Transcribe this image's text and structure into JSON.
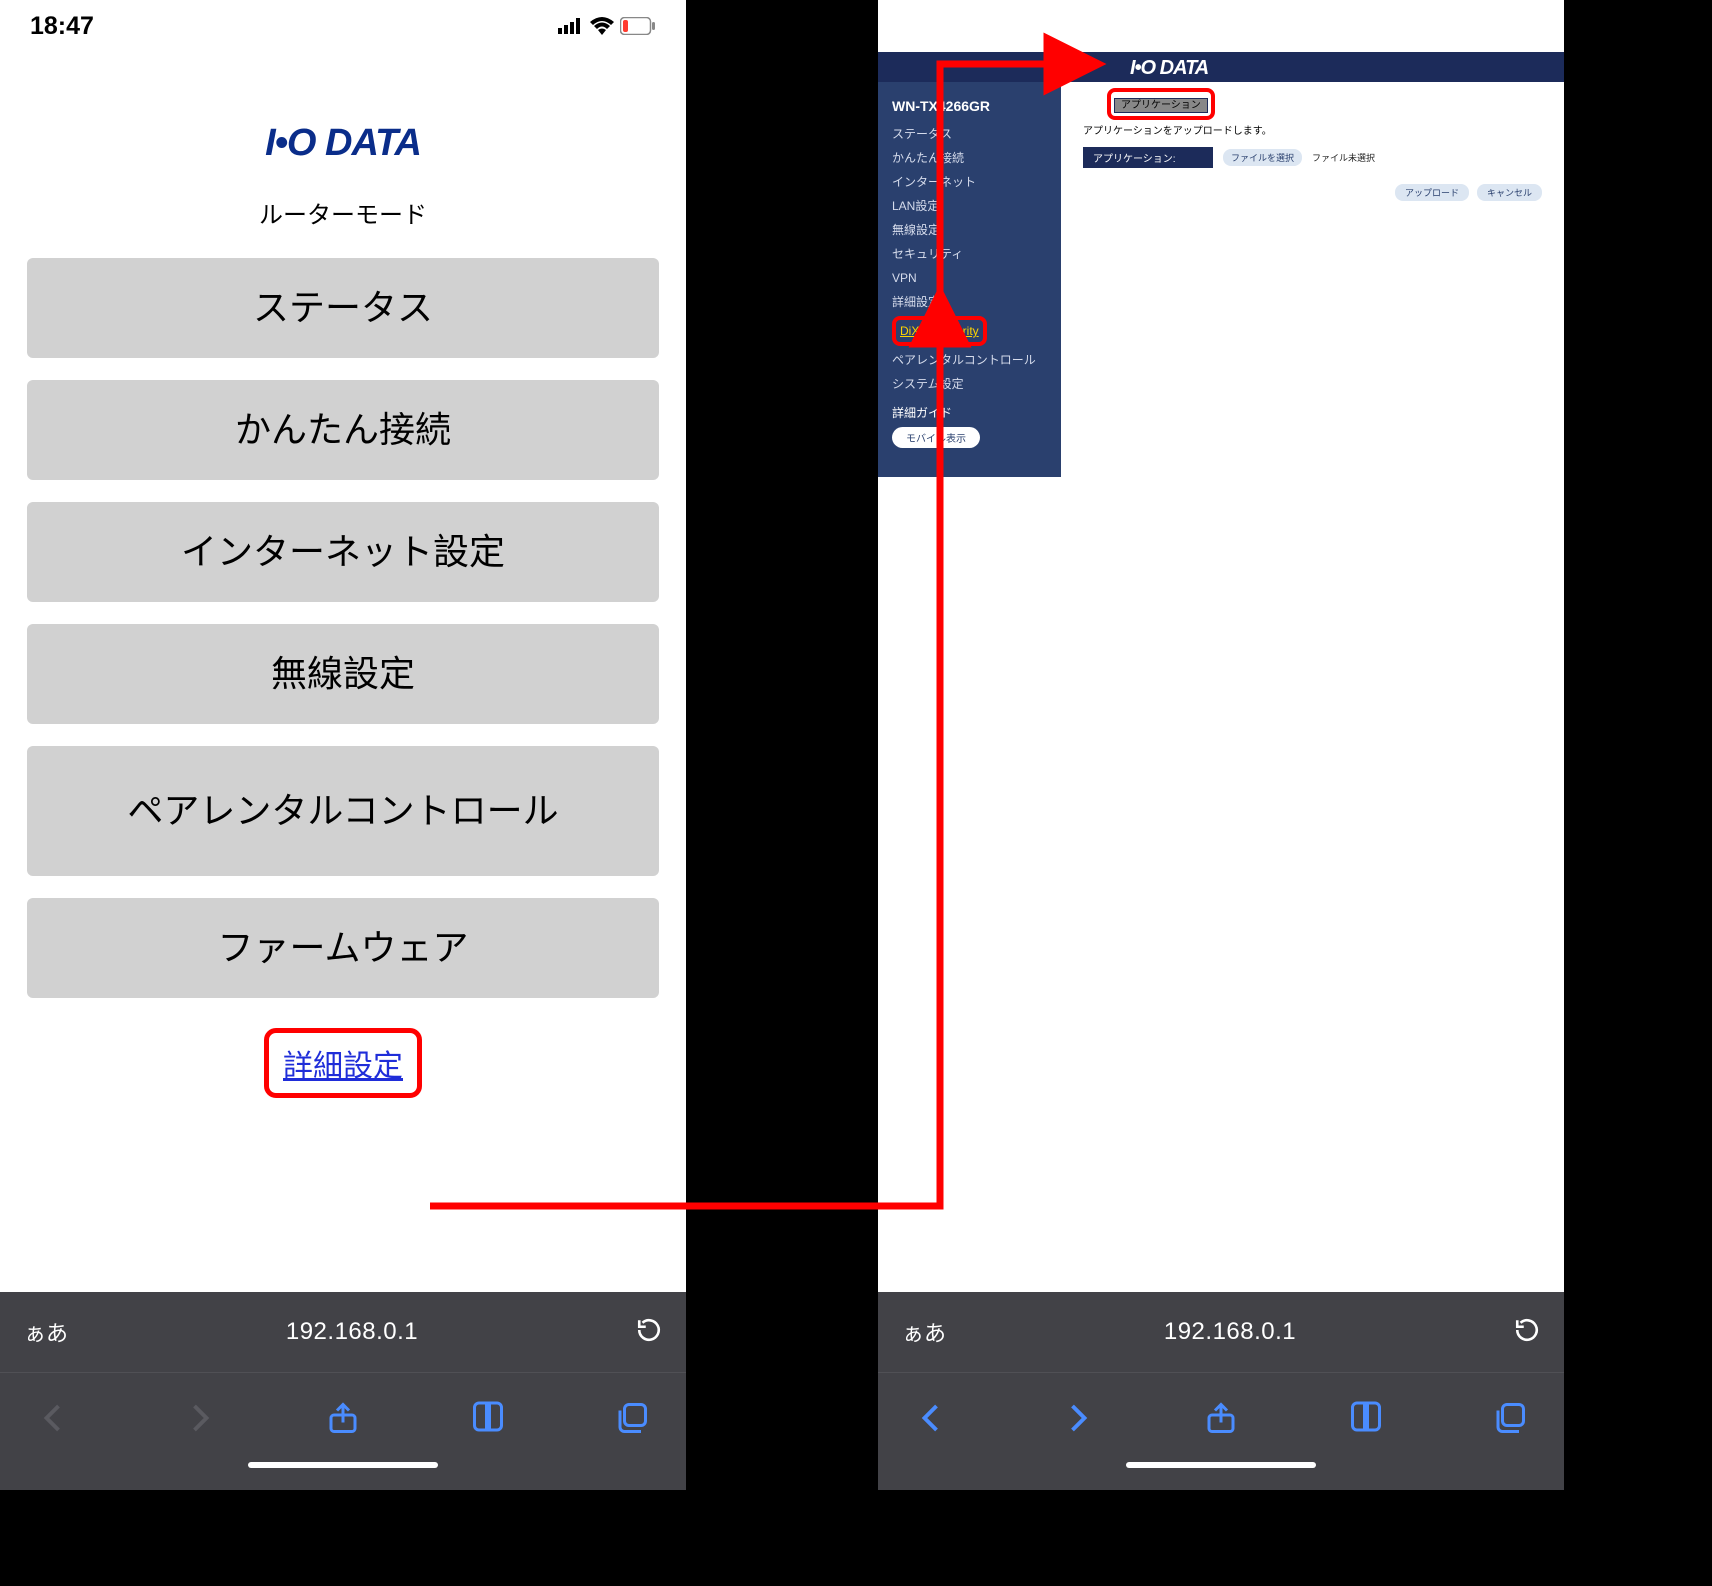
{
  "statusbar": {
    "time": "18:47"
  },
  "left": {
    "logo": "I•O DATA",
    "mode": "ルーターモード",
    "menu": [
      "ステータス",
      "かんたん接続",
      "インターネット設定",
      "無線設定",
      "ペアレンタルコントロール",
      "ファームウェア"
    ],
    "detail_link": "詳細設定"
  },
  "right": {
    "header_logo": "I•O DATA",
    "tab": "アプリケーション",
    "model": "WN-TX4266GR",
    "sidebar": {
      "items_top": [
        "ステータス",
        "かんたん接続",
        "インターネット",
        "LAN設定",
        "無線設定",
        "セキュリティ",
        "VPN",
        "詳細設定"
      ],
      "dixim": "DiXiM Security",
      "items_bottom": [
        "ペアレンタルコントロール",
        "システム設定"
      ],
      "guide": "詳細ガイド",
      "mobile_btn": "モバイル表示"
    },
    "main": {
      "title": "アプリケーションをアップロードします。",
      "field_label": "アプリケーション:",
      "file_btn": "ファイルを選択",
      "file_status": "ファイル未選択",
      "upload_btn": "アップロード",
      "cancel_btn": "キャンセル"
    }
  },
  "browser": {
    "aa": "ぁあ",
    "url": "192.168.0.1"
  }
}
